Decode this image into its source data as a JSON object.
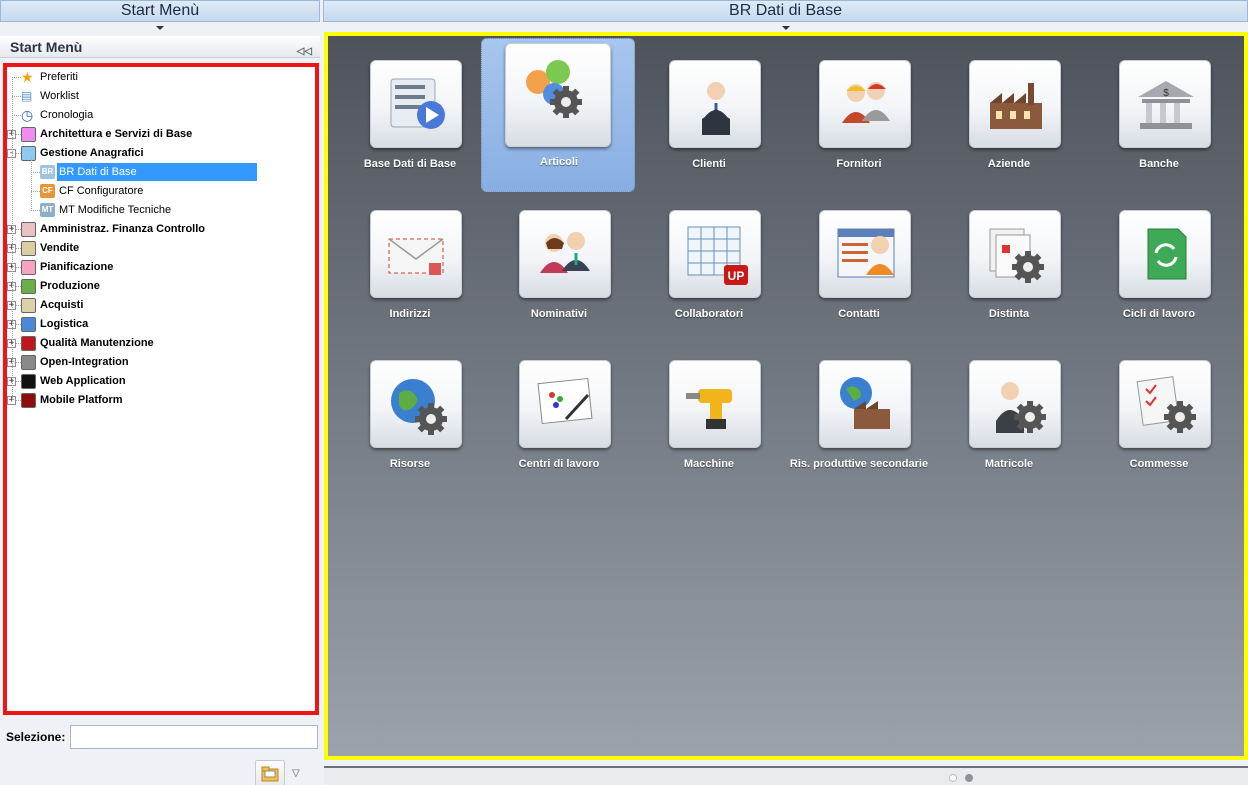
{
  "headers": {
    "left": "Start Menù",
    "right": "BR Dati di Base"
  },
  "panel": {
    "title": "Start Menù",
    "selection_label": "Selezione:",
    "selection_value": ""
  },
  "tree": [
    {
      "label": "Preferiti",
      "bold": false,
      "level": 0,
      "expandable": false,
      "icon": "star-icon"
    },
    {
      "label": "Worklist",
      "bold": false,
      "level": 0,
      "expandable": false,
      "icon": "worklist-icon"
    },
    {
      "label": "Cronologia",
      "bold": false,
      "level": 0,
      "expandable": false,
      "icon": "clock-icon"
    },
    {
      "label": "Architettura e Servizi di Base",
      "bold": true,
      "level": 0,
      "expandable": true,
      "expanded": false,
      "color": "#f08cf0"
    },
    {
      "label": "Gestione Anagrafici",
      "bold": true,
      "level": 0,
      "expandable": true,
      "expanded": true,
      "color": "#8ec9f2"
    },
    {
      "label": "BR Dati di Base",
      "bold": false,
      "level": 1,
      "badge": "BR",
      "badge_color": "#9ec4e2",
      "selected": true
    },
    {
      "label": "CF Configuratore",
      "bold": false,
      "level": 1,
      "badge": "CF",
      "badge_color": "#e8953a"
    },
    {
      "label": "MT Modifiche Tecniche",
      "bold": false,
      "level": 1,
      "badge": "MT",
      "badge_color": "#8faec9"
    },
    {
      "label": "Amministraz. Finanza Controllo",
      "bold": true,
      "level": 0,
      "expandable": true,
      "color": "#eac1c1"
    },
    {
      "label": "Vendite",
      "bold": true,
      "level": 0,
      "expandable": true,
      "color": "#d9cfa0"
    },
    {
      "label": "Pianificazione",
      "bold": true,
      "level": 0,
      "expandable": true,
      "color": "#f5a3c4"
    },
    {
      "label": "Produzione",
      "bold": true,
      "level": 0,
      "expandable": true,
      "color": "#6cae48"
    },
    {
      "label": "Acquisti",
      "bold": true,
      "level": 0,
      "expandable": true,
      "color": "#dcd2aa"
    },
    {
      "label": "Logistica",
      "bold": true,
      "level": 0,
      "expandable": true,
      "color": "#4b88d8"
    },
    {
      "label": "Qualità Manutenzione",
      "bold": true,
      "level": 0,
      "expandable": true,
      "color": "#c0171d"
    },
    {
      "label": "Open-Integration",
      "bold": true,
      "level": 0,
      "expandable": true,
      "color": "#8a8a8a"
    },
    {
      "label": "Web Application",
      "bold": true,
      "level": 0,
      "expandable": true,
      "color": "#111111"
    },
    {
      "label": "Mobile Platform",
      "bold": true,
      "level": 0,
      "expandable": true,
      "color": "#8e0d0d"
    }
  ],
  "tiles": [
    {
      "label": "Base Dati di Base",
      "icon": "list-play-icon"
    },
    {
      "label": "Articoli",
      "icon": "articles-gear-icon",
      "active": true
    },
    {
      "label": "Clienti",
      "icon": "businessman-icon"
    },
    {
      "label": "Fornitori",
      "icon": "workers-icon"
    },
    {
      "label": "Aziende",
      "icon": "factory-icon"
    },
    {
      "label": "Banche",
      "icon": "bank-icon"
    },
    {
      "label": "Indirizzi",
      "icon": "envelope-icon"
    },
    {
      "label": "Nominativi",
      "icon": "people-icon"
    },
    {
      "label": "Collaboratori",
      "icon": "table-up-icon"
    },
    {
      "label": "Contatti",
      "icon": "contacts-card-icon"
    },
    {
      "label": "Distinta",
      "icon": "documents-gear-icon"
    },
    {
      "label": "Cicli di lavoro",
      "icon": "cycle-doc-icon"
    },
    {
      "label": "Risorse",
      "icon": "globe-gear-icon"
    },
    {
      "label": "Centri di lavoro",
      "icon": "board-icon"
    },
    {
      "label": "Macchine",
      "icon": "drill-icon"
    },
    {
      "label": "Ris. produttive secondarie",
      "icon": "factory-globe-icon"
    },
    {
      "label": "Matricole",
      "icon": "person-gear-icon"
    },
    {
      "label": "Commesse",
      "icon": "checklist-gear-icon"
    }
  ],
  "pager": {
    "pages": 2,
    "current": 1
  }
}
